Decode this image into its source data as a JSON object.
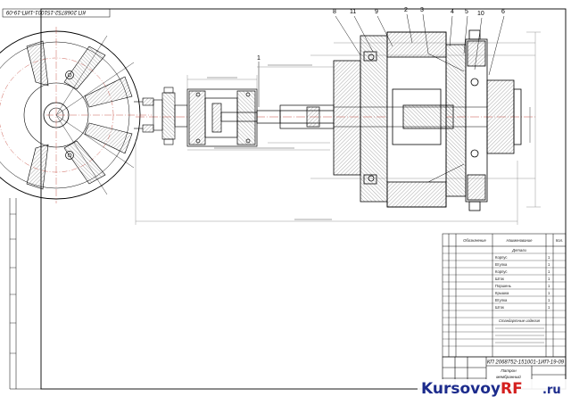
{
  "drawing": {
    "stamp_code": "КП 2068752-151001-1ИП-19-09",
    "title_code": "КП 2068752-151001-1ИП-19-09",
    "title_words": [
      "Патрон",
      "мембранный"
    ],
    "callouts": [
      "1",
      "8",
      "11",
      "9",
      "2",
      "3",
      "4",
      "5",
      "10",
      "6"
    ],
    "spec_table": {
      "headers": [
        "Обозначение",
        "Наименование",
        "Кол."
      ],
      "section_details": "Детали",
      "section_standard": "Стандартные изделия",
      "rows": [
        {
          "name": "Корпус",
          "qty": "1"
        },
        {
          "name": "Втулка",
          "qty": "1"
        },
        {
          "name": "Корпус",
          "qty": "1"
        },
        {
          "name": "Шток",
          "qty": "1"
        },
        {
          "name": "Поршень",
          "qty": "1"
        },
        {
          "name": "Крышка",
          "qty": "1"
        },
        {
          "name": "Втулка",
          "qty": "1"
        },
        {
          "name": "Шток",
          "qty": "1"
        }
      ]
    }
  },
  "watermark": {
    "brand": "Kursovoy",
    "accent": "RF",
    "domain": ".ru"
  },
  "colors": {
    "line": "#000000",
    "center_line": "#c0392b",
    "dimension": "#6b6b6b",
    "hatch": "#555555",
    "watermark_blue": "#1c2b8c",
    "watermark_red": "#d4201f"
  }
}
